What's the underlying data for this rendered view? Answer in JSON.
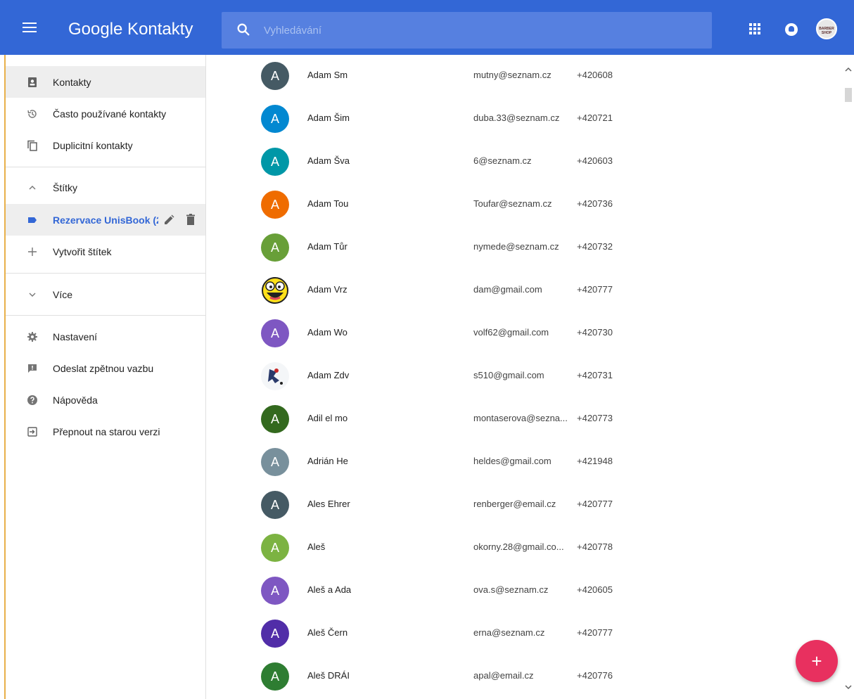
{
  "header": {
    "title": "Google Kontakty",
    "search_placeholder": "Vyhledávání",
    "brand_color": "#3367d6",
    "avatar_label": "BARBER SHOP"
  },
  "sidebar": {
    "items": [
      {
        "label": "Kontakty",
        "icon": "contacts-icon"
      },
      {
        "label": "Často používané kontakty",
        "icon": "history-icon"
      },
      {
        "label": "Duplicitní kontakty",
        "icon": "duplicate-icon"
      }
    ],
    "labels_section": {
      "label": "Štítky",
      "icon": "chevron-up-icon"
    },
    "label_items": [
      {
        "label": "Rezervace UnisBook (2",
        "icon": "label-icon"
      }
    ],
    "create_label": {
      "label": "Vytvořit štítek",
      "icon": "plus-icon"
    },
    "more": {
      "label": "Více",
      "icon": "chevron-down-icon"
    },
    "bottom_items": [
      {
        "label": "Nastavení",
        "icon": "gear-icon"
      },
      {
        "label": "Odeslat zpětnou vazbu",
        "icon": "feedback-icon"
      },
      {
        "label": "Nápověda",
        "icon": "help-icon"
      },
      {
        "label": "Přepnout na starou verzi",
        "icon": "exit-icon"
      }
    ]
  },
  "contacts": [
    {
      "initial": "A",
      "color": "#455a64",
      "name": "Adam Sm",
      "email": "mutny@seznam.cz",
      "phone": "+420608"
    },
    {
      "initial": "A",
      "color": "#0288d1",
      "name": "Adam Šim",
      "email": "duba.33@seznam.cz",
      "phone": "+420721"
    },
    {
      "initial": "A",
      "color": "#0097a7",
      "name": "Adam Šva",
      "email": "6@seznam.cz",
      "phone": "+420603"
    },
    {
      "initial": "A",
      "color": "#ef6c00",
      "name": "Adam Tou",
      "email": "Toufar@seznam.cz",
      "phone": "+420736"
    },
    {
      "initial": "A",
      "color": "#689f38",
      "name": "Adam Tůr",
      "email": "nymede@seznam.cz",
      "phone": "+420732"
    },
    {
      "initial": "",
      "color": "emoji",
      "name": "Adam Vrz",
      "email": "dam@gmail.com",
      "phone": "+420777"
    },
    {
      "initial": "A",
      "color": "#7e57c2",
      "name": "Adam Wo",
      "email": "volf62@gmail.com",
      "phone": "+420730"
    },
    {
      "initial": "",
      "color": "photo",
      "name": "Adam Zdv",
      "email": "s510@gmail.com",
      "phone": "+420731"
    },
    {
      "initial": "A",
      "color": "#33691e",
      "name": "Adil el mo",
      "email": "montaserova@sezna...",
      "phone": "+420773"
    },
    {
      "initial": "A",
      "color": "#78909c",
      "name": "Adrián He",
      "email": "heldes@gmail.com",
      "phone": "+421948"
    },
    {
      "initial": "A",
      "color": "#455a64",
      "name": "Ales Ehrer",
      "email": "renberger@email.cz",
      "phone": "+420777"
    },
    {
      "initial": "A",
      "color": "#7cb342",
      "name": "Aleš",
      "email": "okorny.28@gmail.co...",
      "phone": "+420778"
    },
    {
      "initial": "A",
      "color": "#7e57c2",
      "name": "Aleš a Ada",
      "email": "ova.s@seznam.cz",
      "phone": "+420605"
    },
    {
      "initial": "A",
      "color": "#512da8",
      "name": "Aleš Čern",
      "email": "erna@seznam.cz",
      "phone": "+420777"
    },
    {
      "initial": "A",
      "color": "#2e7d32",
      "name": "Aleš DRÁI",
      "email": "apal@email.cz",
      "phone": "+420776"
    }
  ],
  "fab": {
    "label": "+"
  }
}
